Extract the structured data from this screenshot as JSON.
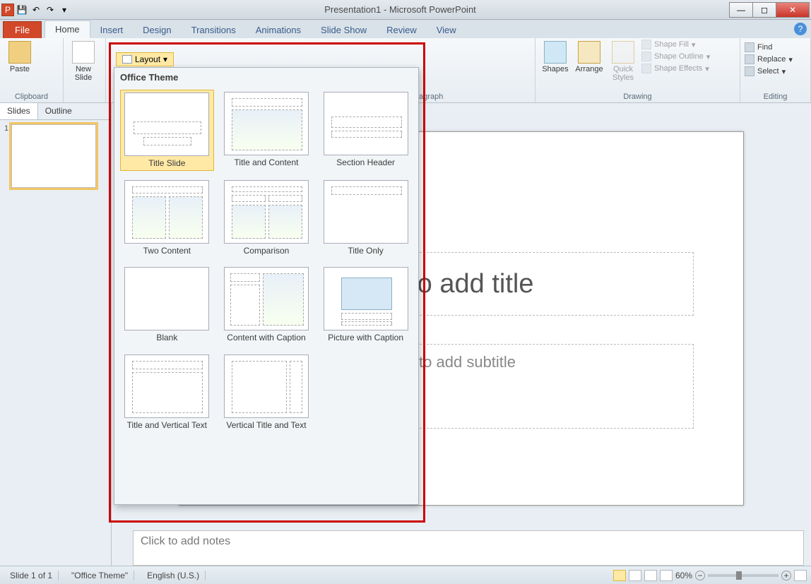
{
  "titlebar": {
    "title": "Presentation1 - Microsoft PowerPoint"
  },
  "tabs": {
    "file": "File",
    "list": [
      "Home",
      "Insert",
      "Design",
      "Transitions",
      "Animations",
      "Slide Show",
      "Review",
      "View"
    ],
    "active": "Home"
  },
  "ribbon": {
    "clipboard": {
      "label": "Clipboard",
      "paste": "Paste"
    },
    "slides": {
      "newslide": "New\nSlide",
      "layout": "Layout"
    },
    "paragraph": {
      "label": "Paragraph"
    },
    "drawing": {
      "label": "Drawing",
      "shapes": "Shapes",
      "arrange": "Arrange",
      "quick": "Quick\nStyles",
      "fill": "Shape Fill",
      "outline": "Shape Outline",
      "effects": "Shape Effects"
    },
    "editing": {
      "label": "Editing",
      "find": "Find",
      "replace": "Replace",
      "select": "Select"
    }
  },
  "layout_dropdown": {
    "header": "Office Theme",
    "items": [
      {
        "label": "Title Slide",
        "selected": true
      },
      {
        "label": "Title and Content"
      },
      {
        "label": "Section Header"
      },
      {
        "label": "Two Content"
      },
      {
        "label": "Comparison"
      },
      {
        "label": "Title Only"
      },
      {
        "label": "Blank"
      },
      {
        "label": "Content with Caption"
      },
      {
        "label": "Picture with Caption"
      },
      {
        "label": "Title and Vertical Text"
      },
      {
        "label": "Vertical Title and Text"
      }
    ]
  },
  "panel": {
    "tabs": [
      "Slides",
      "Outline"
    ],
    "slide_num": "1"
  },
  "slide": {
    "title": "k to add title",
    "subtitle": "k to add subtitle"
  },
  "notes": {
    "placeholder": "Click to add notes"
  },
  "status": {
    "slide": "Slide 1 of 1",
    "theme": "\"Office Theme\"",
    "lang": "English (U.S.)",
    "zoom": "60%"
  }
}
